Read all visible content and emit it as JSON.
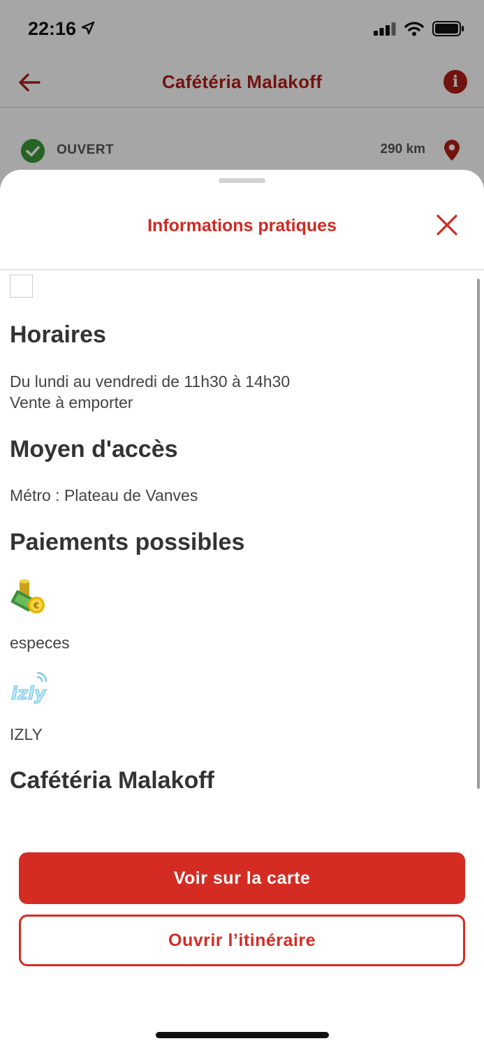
{
  "status_bar": {
    "time": "22:16",
    "location_icon": "location-arrow-icon",
    "signal_icon": "cellular-signal-icon",
    "wifi_icon": "wifi-icon",
    "battery_icon": "battery-icon"
  },
  "header": {
    "back_icon": "arrow-left-icon",
    "title": "Cafétéria Malakoff",
    "info_label": "i",
    "info_icon": "info-icon"
  },
  "status": {
    "open_label": "OUVERT",
    "open_icon": "check-circle-icon",
    "distance": "290 km",
    "pin_icon": "map-pin-icon"
  },
  "sheet": {
    "title": "Informations pratiques",
    "close_icon": "close-icon",
    "sections": {
      "horaires": {
        "heading": "Horaires",
        "line1": "Du lundi au vendredi de 11h30 à 14h30",
        "line2": "Vente à emporter"
      },
      "acces": {
        "heading": "Moyen d'accès",
        "text": "Métro : Plateau de Vanves"
      },
      "paiements": {
        "heading": "Paiements possibles",
        "methods": [
          {
            "label": "especes",
            "icon": "cash-coins-icon"
          },
          {
            "label": "IZLY",
            "icon": "izly-logo-icon"
          }
        ]
      },
      "name_heading": "Cafétéria Malakoff"
    }
  },
  "actions": {
    "primary_label": "Voir sur la carte",
    "secondary_label": "Ouvrir l’itinéraire"
  },
  "colors": {
    "brand_red": "#d42c23",
    "header_red": "#b01e17",
    "open_green": "#3a9a3a",
    "text_dark": "#333333"
  }
}
